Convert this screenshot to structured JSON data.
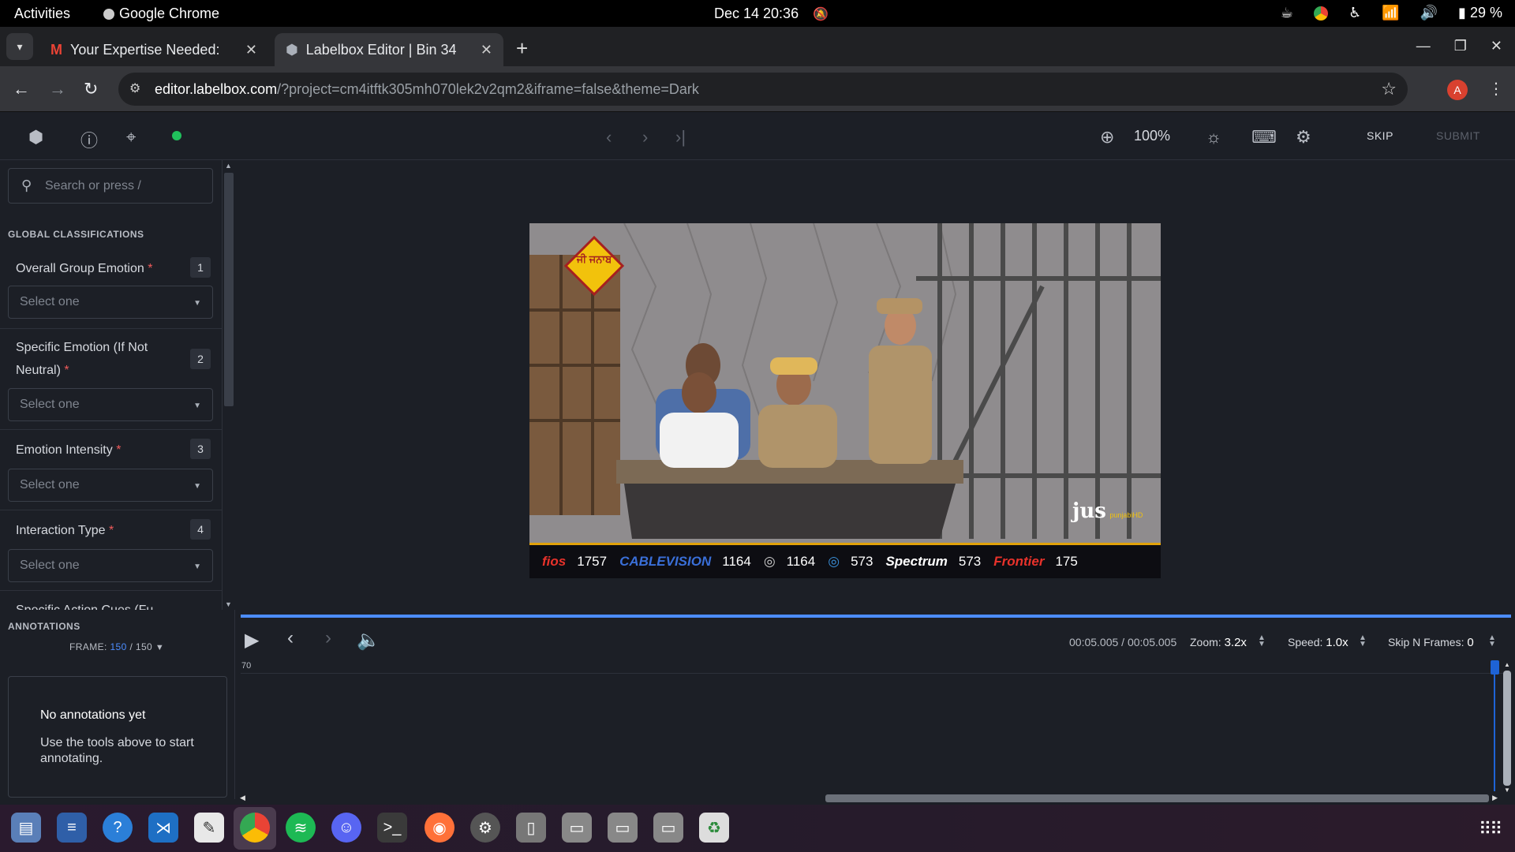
{
  "system_bar": {
    "activities": "Activities",
    "app_name": "Google Chrome",
    "clock": "Dec 14  20:36",
    "battery": "29 %"
  },
  "browser": {
    "tabs": [
      {
        "title": "Your Expertise Needed: ",
        "active": false
      },
      {
        "title": "Labelbox Editor | Bin 34",
        "active": true
      }
    ],
    "url_host": "editor.labelbox.com",
    "url_path": "/?project=cm4itftk305mh070lek2v2qm2&iframe=false&theme=Dark",
    "profile_initial": "A"
  },
  "editor": {
    "zoom": "100%",
    "skip_label": "SKIP",
    "submit_label": "SUBMIT",
    "status_color": "#20c05c"
  },
  "sidebar": {
    "search_placeholder": "Search or press /",
    "section_title": "GLOBAL CLASSIFICATIONS",
    "questions": [
      {
        "label": "Overall Group Emotion",
        "required": "*",
        "number": "1",
        "placeholder": "Select one"
      },
      {
        "label": "Specific Emotion (If Not Neutral)",
        "required": "*",
        "number": "2",
        "placeholder": "Select one"
      },
      {
        "label": "Emotion Intensity",
        "required": "*",
        "number": "3",
        "placeholder": "Select one"
      },
      {
        "label": "Interaction Type",
        "required": "*",
        "number": "4",
        "placeholder": "Select one"
      },
      {
        "label": "Specific Action Cues (Fu",
        "required": "",
        "number": "",
        "placeholder": ""
      }
    ]
  },
  "annotations": {
    "title": "ANNOTATIONS",
    "frame_label": "FRAME:",
    "frame_current": "150",
    "frame_total": "/ 150",
    "empty_title": "No annotations yet",
    "empty_body": "Use the tools above to start annotating."
  },
  "video": {
    "logo_text": "jus",
    "logo_sub": "punjabiHD",
    "badge_text": "ਜੀ ਜਨਾਬ",
    "ticker": [
      {
        "brand": "fios",
        "number": "1757",
        "color": "#e8322b"
      },
      {
        "brand": "CABLEVISION",
        "number": "1164",
        "color": "#3a6fd8"
      },
      {
        "brand": "",
        "number": "1164",
        "color": "#cfcfcf"
      },
      {
        "brand": "",
        "number": "573",
        "color": "#3a8fd8"
      },
      {
        "brand": "Spectrum",
        "number": "573",
        "color": "#ffffff"
      },
      {
        "brand": "Frontier",
        "number": "175",
        "color": "#e8322b"
      }
    ]
  },
  "timeline": {
    "time": "00:05.005 / 00:05.005",
    "zoom_label": "Zoom:",
    "zoom_value": "3.2x",
    "speed_label": "Speed:",
    "speed_value": "1.0x",
    "skip_label": "Skip N Frames:",
    "skip_value": "0",
    "ruler_tick": "70",
    "progress_fraction": 1.0
  }
}
